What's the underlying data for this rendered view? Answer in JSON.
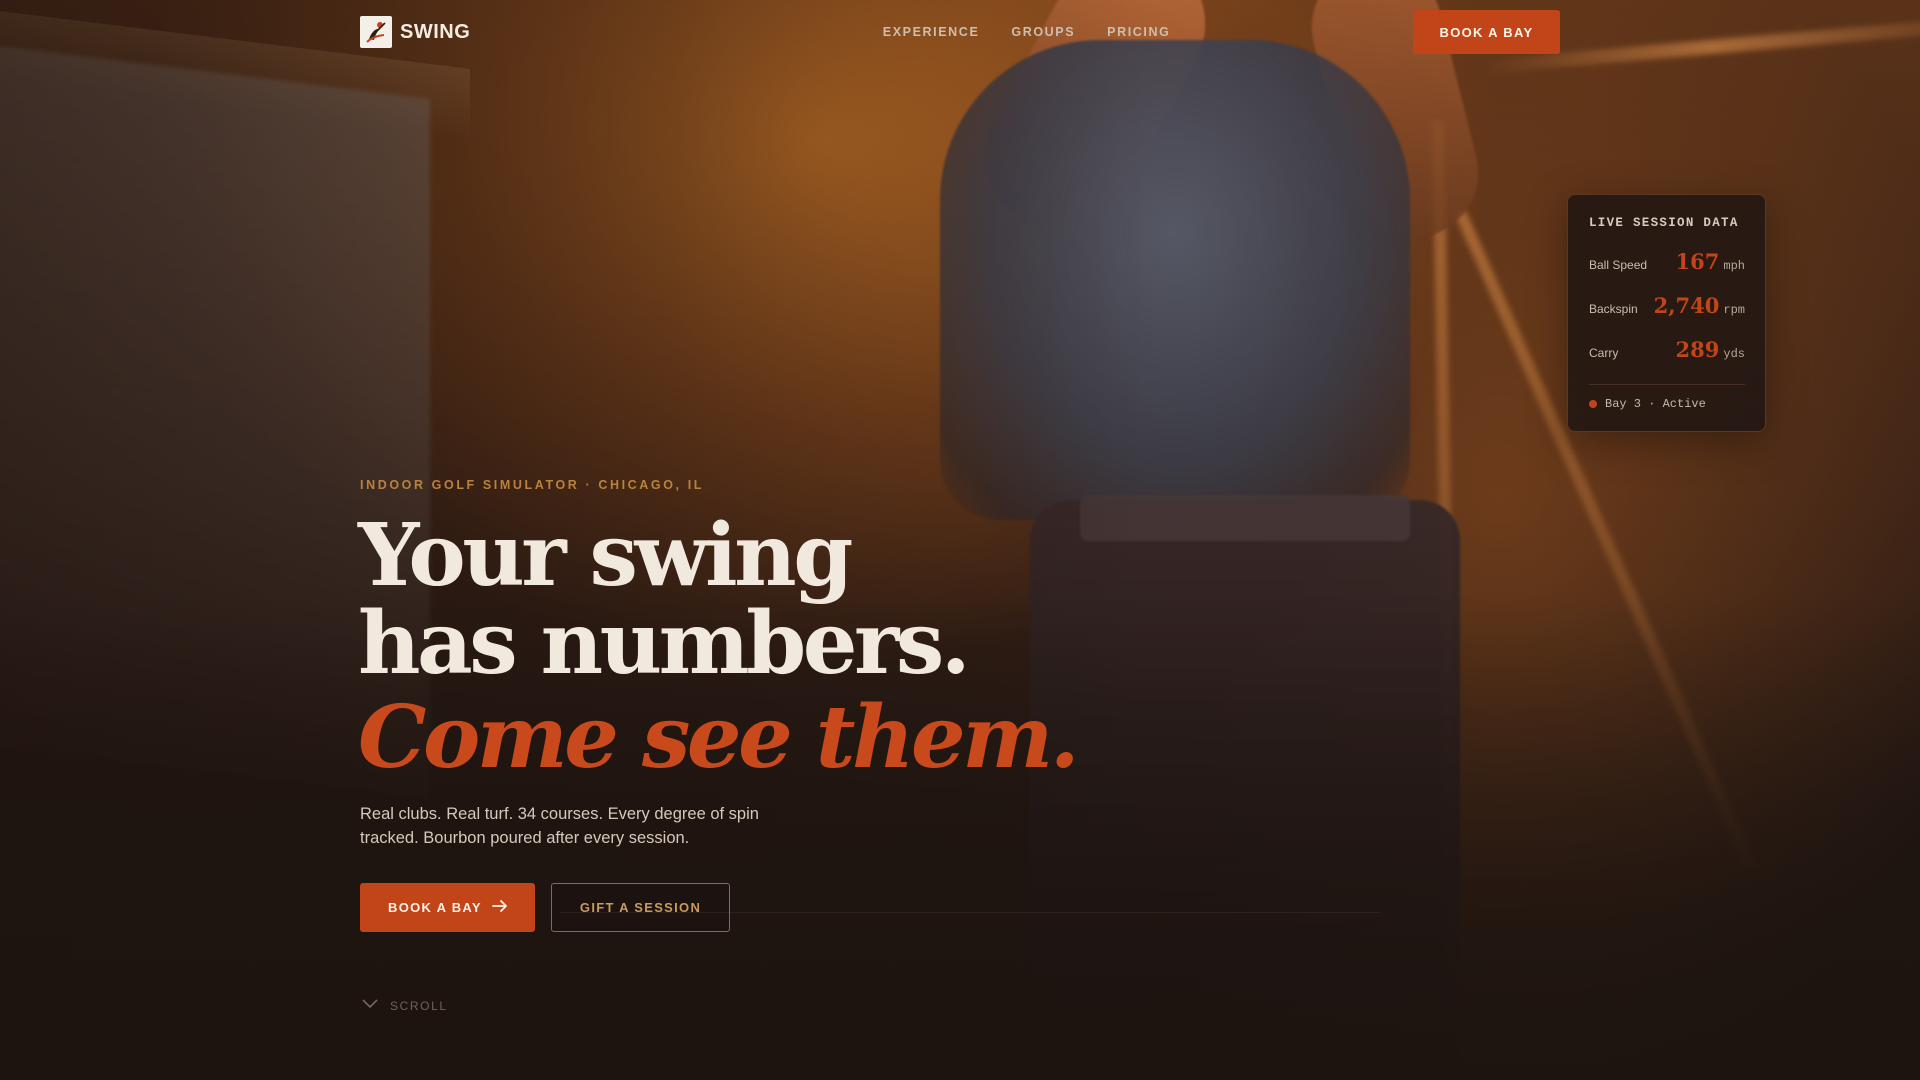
{
  "nav": {
    "brand_name": "SWING",
    "links": [
      "EXPERIENCE",
      "GROUPS",
      "PRICING"
    ],
    "cta_label": "BOOK A BAY"
  },
  "hero": {
    "eyebrow": "INDOOR GOLF SIMULATOR · CHICAGO, IL",
    "headline_line1": "Your swing",
    "headline_line2": "has numbers.",
    "headline_accent": "Come see them.",
    "lede": "Real clubs. Real turf. 34 courses. Every degree of spin tracked. Bourbon poured after every session.",
    "primary_cta": "BOOK A BAY",
    "secondary_cta": "GIFT A SESSION",
    "scroll_label": "SCROLL"
  },
  "session_card": {
    "title": "LIVE SESSION DATA",
    "metrics": [
      {
        "label": "Ball Speed",
        "value": "167",
        "unit": "mph"
      },
      {
        "label": "Backspin",
        "value": "2,740",
        "unit": "rpm"
      },
      {
        "label": "Carry",
        "value": "289",
        "unit": "yds"
      }
    ],
    "status": "Bay 3 · Active"
  },
  "colors": {
    "accent": "#c2451a",
    "eyebrow": "#b9823e",
    "headline": "#f1e9de",
    "background": "#1d1410"
  },
  "icons": {
    "logo": "golfer-logo-icon",
    "primary_cta": "arrow-right-icon",
    "scroll": "chevron-down-icon",
    "status": "status-dot-icon"
  }
}
